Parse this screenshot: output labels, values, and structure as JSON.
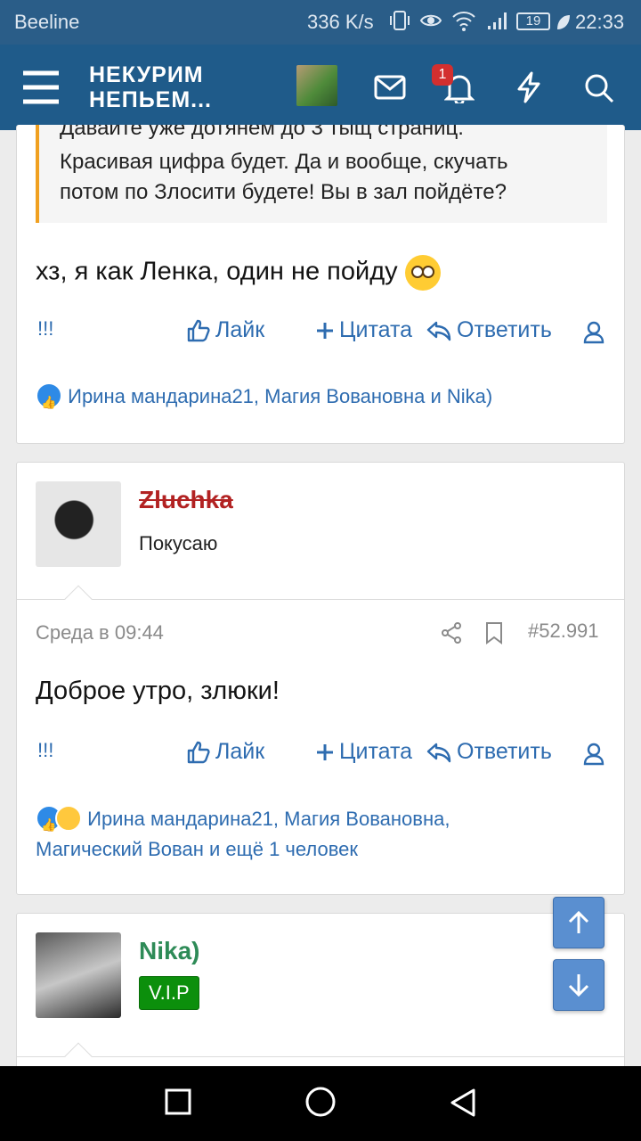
{
  "status_bar": {
    "carrier": "Beeline",
    "speed": "336 K/s",
    "battery": "19",
    "time": "22:33"
  },
  "navbar": {
    "logo_line1": "НЕКУРИМ",
    "logo_line2": "НЕПЬЕМ...",
    "notification_count": "1",
    "icons": [
      "menu-icon",
      "avatar",
      "envelope-icon",
      "bell-icon",
      "lightning-icon",
      "search-icon"
    ]
  },
  "post1": {
    "quote_lines": [
      "Давайте уже дотянем до 3 тыщ страниц.",
      "Красивая цифра будет. Да и вообще, скучать",
      "потом по Злосити будете! Вы в зал пойдёте?"
    ],
    "message": "хз, я как Ленка, один не пойду",
    "reactions_text": "Ирина мандарина21, Магия Вовановна и Nika)"
  },
  "actions": {
    "marks": "!!!",
    "like": "Лайк",
    "quote": "Цитата",
    "reply": "Ответить"
  },
  "post2": {
    "author": "Zluchka",
    "user_title": "Покусаю",
    "date": "Среда в 09:44",
    "post_number": "#52.991",
    "message": "Доброе утро, злюки!",
    "reactions_line1": "Ирина мандарина21, Магия Вовановна,",
    "reactions_line2": "Магический Вован и ещё 1 человек"
  },
  "post3": {
    "author": "Nika)",
    "badge": "V.I.P"
  },
  "colors": {
    "navbar": "#1f5b8a",
    "link": "#2e6cb0",
    "quote_bar": "#f0a020",
    "vip": "#0c8f0c"
  }
}
